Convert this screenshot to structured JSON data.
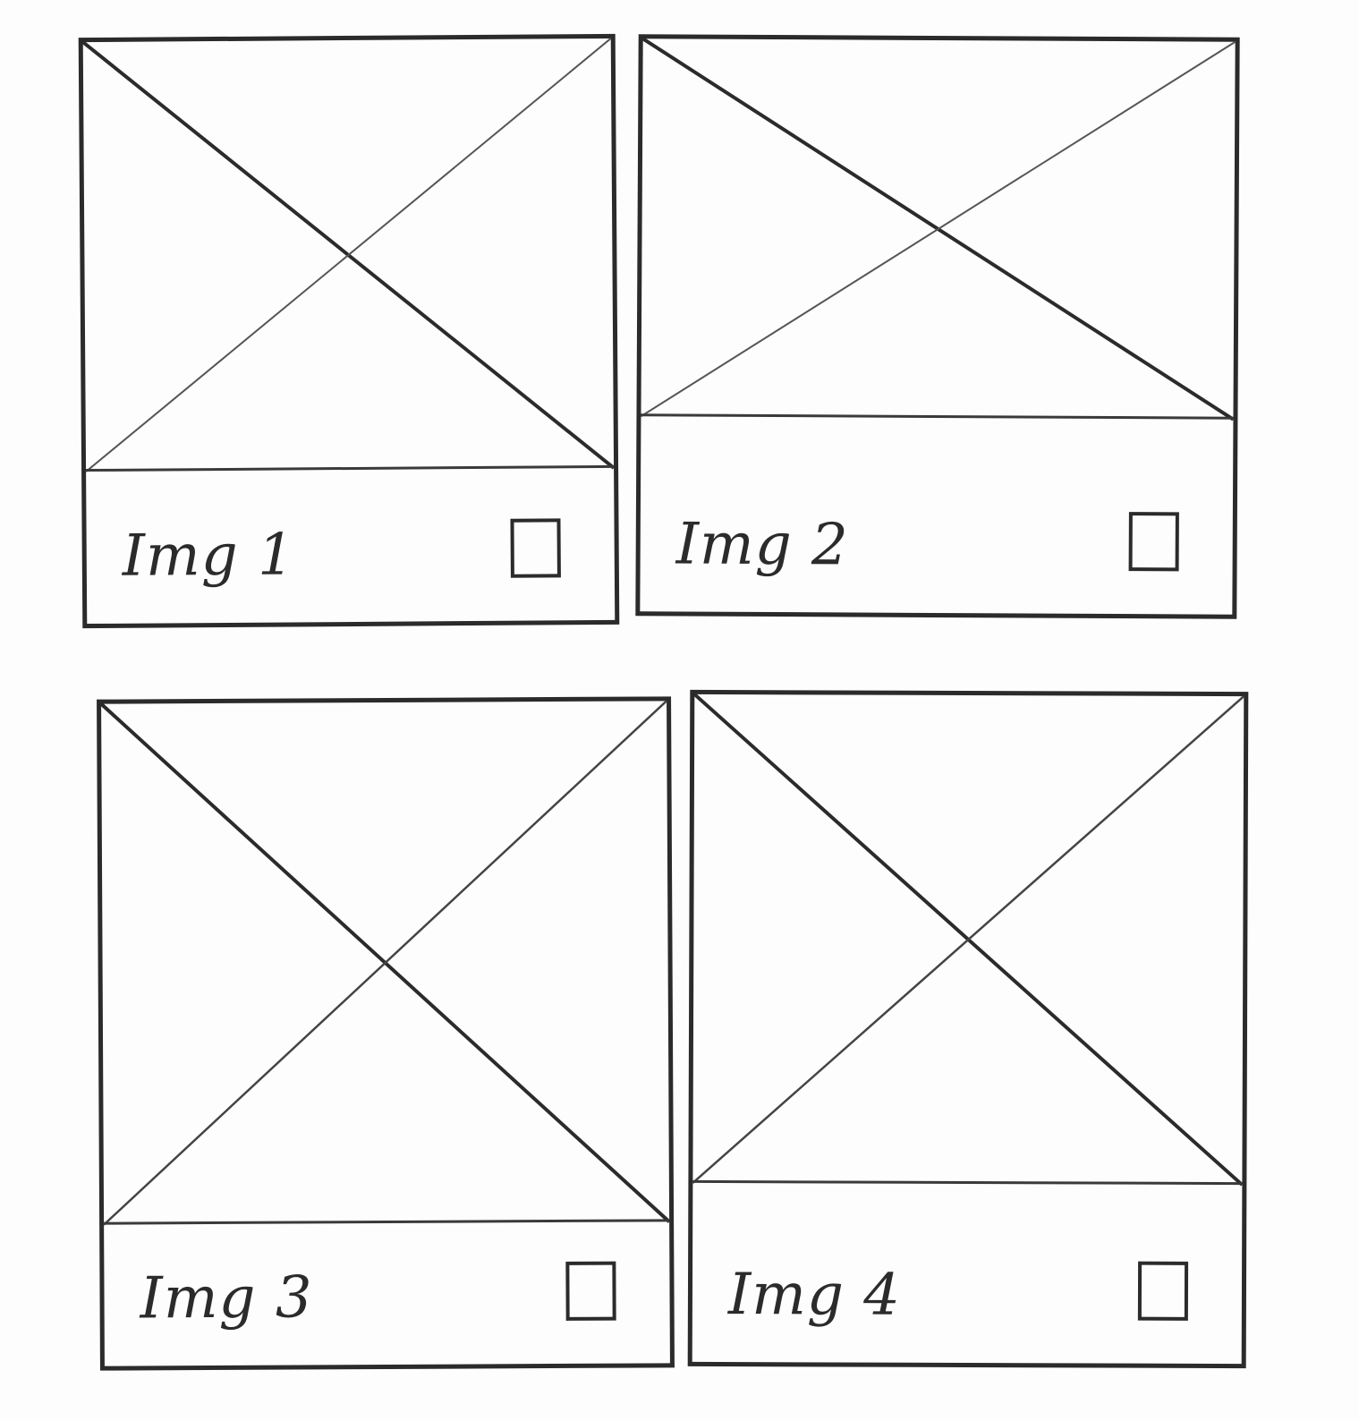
{
  "colors": {
    "ink": "#2b2b2b",
    "paper": "#fdfdfd"
  },
  "gallery": {
    "cards": [
      {
        "caption": "Img 1",
        "image_icon": "image-placeholder-icon",
        "checkbox": "unchecked"
      },
      {
        "caption": "Img 2",
        "image_icon": "image-placeholder-icon",
        "checkbox": "unchecked"
      },
      {
        "caption": "Img 3",
        "image_icon": "image-placeholder-icon",
        "checkbox": "unchecked"
      },
      {
        "caption": "Img 4",
        "image_icon": "image-placeholder-icon",
        "checkbox": "unchecked"
      }
    ]
  }
}
